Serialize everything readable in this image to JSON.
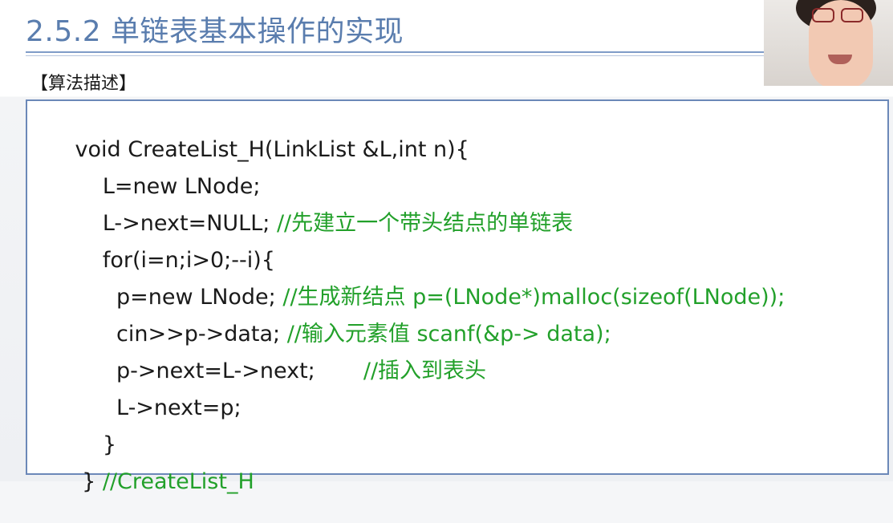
{
  "slide": {
    "title": "2.5.2 单链表基本操作的实现",
    "section_label": "【算法描述】"
  },
  "code": [
    {
      "code": "void CreateList_H(LinkList &L,int n){",
      "comment": ""
    },
    {
      "code": "    L=new LNode;",
      "comment": ""
    },
    {
      "code": "    L->next=NULL; ",
      "comment": "//先建立一个带头结点的单链表"
    },
    {
      "code": "    for(i=n;i>0;--i){",
      "comment": ""
    },
    {
      "code": "      p=new LNode; ",
      "comment": "//生成新结点 p=(LNode*)malloc(sizeof(LNode));"
    },
    {
      "code": "      cin>>p->data; ",
      "comment": "//输入元素值 scanf(&p-> data);"
    },
    {
      "code": "      p->next=L->next;       ",
      "comment": "//插入到表头"
    },
    {
      "code": "      L->next=p;",
      "comment": ""
    },
    {
      "code": "    }",
      "comment": ""
    },
    {
      "code": " } ",
      "comment": "//CreateList_H"
    }
  ],
  "colors": {
    "title": "#5a7dae",
    "border": "#6b88b8",
    "comment": "#22a02a",
    "code": "#1a1a1a"
  }
}
